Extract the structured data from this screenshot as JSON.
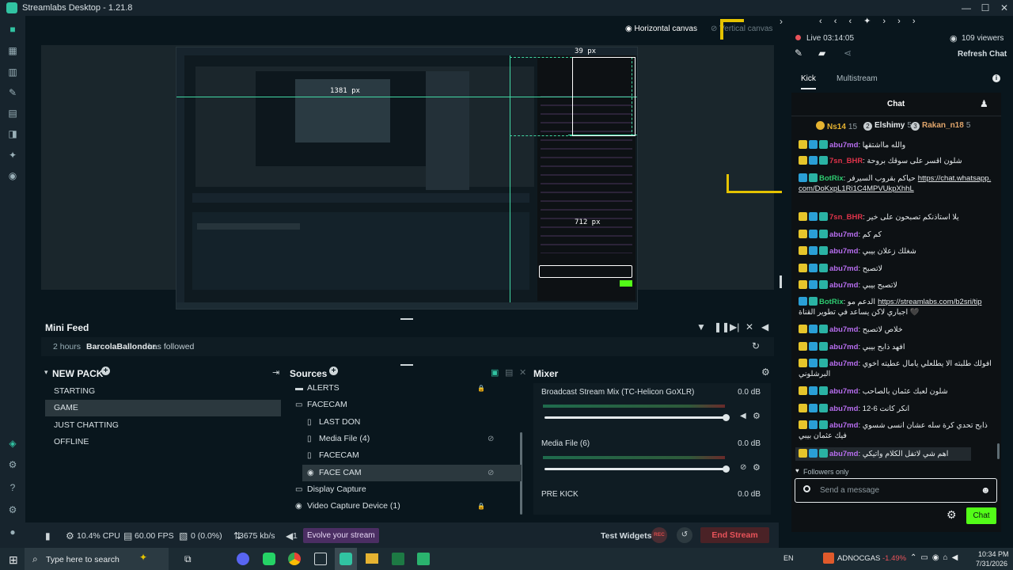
{
  "app": {
    "title": "Streamlabs Desktop - 1.21.8"
  },
  "canvas_toggle": {
    "horizontal": "Horizontal canvas",
    "vertical": "Vertical canvas"
  },
  "preview_overlay": {
    "measure1": "1381 px",
    "measure2": "39 px",
    "measure3": "712 px"
  },
  "minifeed": {
    "title": "Mini Feed",
    "time": "2 hours",
    "user": "BarcolaBallondor",
    "action": "has followed"
  },
  "scenes": {
    "title": "NEW PACK",
    "items": [
      "STARTING",
      "GAME",
      "JUST CHATTING",
      "OFFLINE"
    ],
    "active": "GAME"
  },
  "sources": {
    "title": "Sources",
    "items": [
      {
        "label": "ALERTS",
        "icon": "folder-icon",
        "indent": false
      },
      {
        "label": "FACECAM",
        "icon": "folder-open-icon",
        "indent": false
      },
      {
        "label": "LAST DON",
        "icon": "file-icon",
        "indent": true
      },
      {
        "label": "Media File (4)",
        "icon": "file-icon",
        "indent": true
      },
      {
        "label": "FACECAM",
        "icon": "file-icon",
        "indent": true
      },
      {
        "label": "FACE CAM",
        "icon": "webcam-icon",
        "indent": true
      },
      {
        "label": "Display Capture",
        "icon": "monitor-icon",
        "indent": false
      },
      {
        "label": "Video Capture Device (1)",
        "icon": "webcam-icon",
        "indent": false
      }
    ]
  },
  "mixer": {
    "title": "Mixer",
    "items": [
      {
        "name": "Broadcast Stream Mix (TC-Helicon GoXLR)",
        "db": "0.0 dB",
        "level": 1.0
      },
      {
        "name": "Media File (6)",
        "db": "0.0 dB",
        "level": 1.0
      },
      {
        "name": "PRE KICK",
        "db": "0.0 dB",
        "level": 1.0
      }
    ]
  },
  "footer": {
    "cpu": "10.4% CPU",
    "fps": "60.00 FPS",
    "dropped": "0 (0.0%)",
    "bitrate": "3675 kb/s",
    "alert_count": "1",
    "evolve": "Evolve your stream",
    "test_widgets": "Test Widgets",
    "rec": "REC",
    "end_stream": "End Stream"
  },
  "live": {
    "status": "Live 03:14:05",
    "viewers": "109 viewers",
    "refresh": "Refresh Chat"
  },
  "chat_tabs": {
    "kick": "Kick",
    "multistream": "Multistream"
  },
  "chat": {
    "title": "Chat",
    "top_gifters": [
      {
        "rank": "",
        "name": "Ns14",
        "count": "15"
      },
      {
        "rank": "2",
        "name": "Elshimy",
        "count": "5"
      },
      {
        "rank": "3",
        "name": "Rakan_n18",
        "count": "5"
      }
    ],
    "messages": [
      {
        "user": "abu7md",
        "text": "والله مااشتقها",
        "color": "#b86ef0",
        "badges": [
          "b-sub",
          "b-a",
          "b-b"
        ]
      },
      {
        "user": "7sn_BHR",
        "text": "شلون اقسر على سوقك بروحة",
        "color": "#e0334a",
        "badges": [
          "b-sub",
          "b-a",
          "b-b"
        ]
      },
      {
        "user": "BotRix",
        "text": "حياكم بقروب السيرفر",
        "link": "https://chat.whatsapp.com/DoKxpL1Ri1C4MPVUkpXhhL",
        "color": "#2ecc71",
        "badges": [
          "b-a",
          "b-b"
        ]
      },
      {
        "user": "7sn_BHR",
        "text": "يلا استاذنكم تصبحون على خير",
        "color": "#e0334a",
        "badges": [
          "b-sub",
          "b-a",
          "b-b"
        ]
      },
      {
        "user": "abu7md",
        "text": "كم كم",
        "color": "#b86ef0",
        "badges": [
          "b-sub",
          "b-a",
          "b-b"
        ]
      },
      {
        "user": "abu7md",
        "text": "شغلك زعلان بيبي",
        "color": "#b86ef0",
        "badges": [
          "b-sub",
          "b-a",
          "b-b"
        ]
      },
      {
        "user": "abu7md",
        "text": "لاتصبح",
        "color": "#b86ef0",
        "badges": [
          "b-sub",
          "b-a",
          "b-b"
        ]
      },
      {
        "user": "abu7md",
        "text": "لاتصبح بيبي",
        "color": "#b86ef0",
        "badges": [
          "b-sub",
          "b-a",
          "b-b"
        ]
      },
      {
        "user": "BotRix",
        "text": "الدعم مو",
        "link": "https://streamlabs.com/b2sri/tip",
        "text2": "اجباري لاكن يساعد في تطوير القناة 🖤",
        "color": "#2ecc71",
        "badges": [
          "b-a",
          "b-b"
        ]
      },
      {
        "user": "abu7md",
        "text": "خلاص لاتصبح",
        "color": "#b86ef0",
        "badges": [
          "b-sub",
          "b-a",
          "b-b"
        ]
      },
      {
        "user": "abu7md",
        "text": "افهد ذابح بيبي",
        "color": "#b86ef0",
        "badges": [
          "b-sub",
          "b-a",
          "b-b"
        ]
      },
      {
        "user": "abu7md",
        "text": "افولك طلبته الا يطلعلي يامال عطيته اخوي البرشلوني",
        "color": "#b86ef0",
        "badges": [
          "b-sub",
          "b-a",
          "b-b"
        ]
      },
      {
        "user": "abu7md",
        "text": "شلون لعبك عثمان بالصاحب",
        "color": "#b86ef0",
        "badges": [
          "b-sub",
          "b-a",
          "b-b"
        ]
      },
      {
        "user": "abu7md",
        "text": "12-6 انكر كانت",
        "color": "#b86ef0",
        "badges": [
          "b-sub",
          "b-a",
          "b-b"
        ]
      },
      {
        "user": "abu7md",
        "text": "ذابح تحدي كرة سله عشان انسى شسوي فيك عثمان بيبي",
        "color": "#b86ef0",
        "badges": [
          "b-sub",
          "b-a",
          "b-b"
        ]
      },
      {
        "user": "abu7md",
        "text": "اهم شي لاتفل الكلام واتيكي",
        "color": "#b86ef0",
        "badges": [
          "b-sub",
          "b-a",
          "b-b"
        ]
      }
    ],
    "followers_only": "Followers only",
    "input_placeholder": "Send a message",
    "send_label": "Chat"
  },
  "taskbar": {
    "search_placeholder": "Type here to search",
    "lang": "EN",
    "ticker_name": "ADNOCGAS",
    "ticker_change": "-1.49%",
    "time": "10:34 PM",
    "date": "7/31/2026"
  },
  "colors": {
    "accent": "#31c3a2",
    "danger": "#d83a3a",
    "evolve_bg": "#4b2e63",
    "chat_send": "#53fc18"
  }
}
